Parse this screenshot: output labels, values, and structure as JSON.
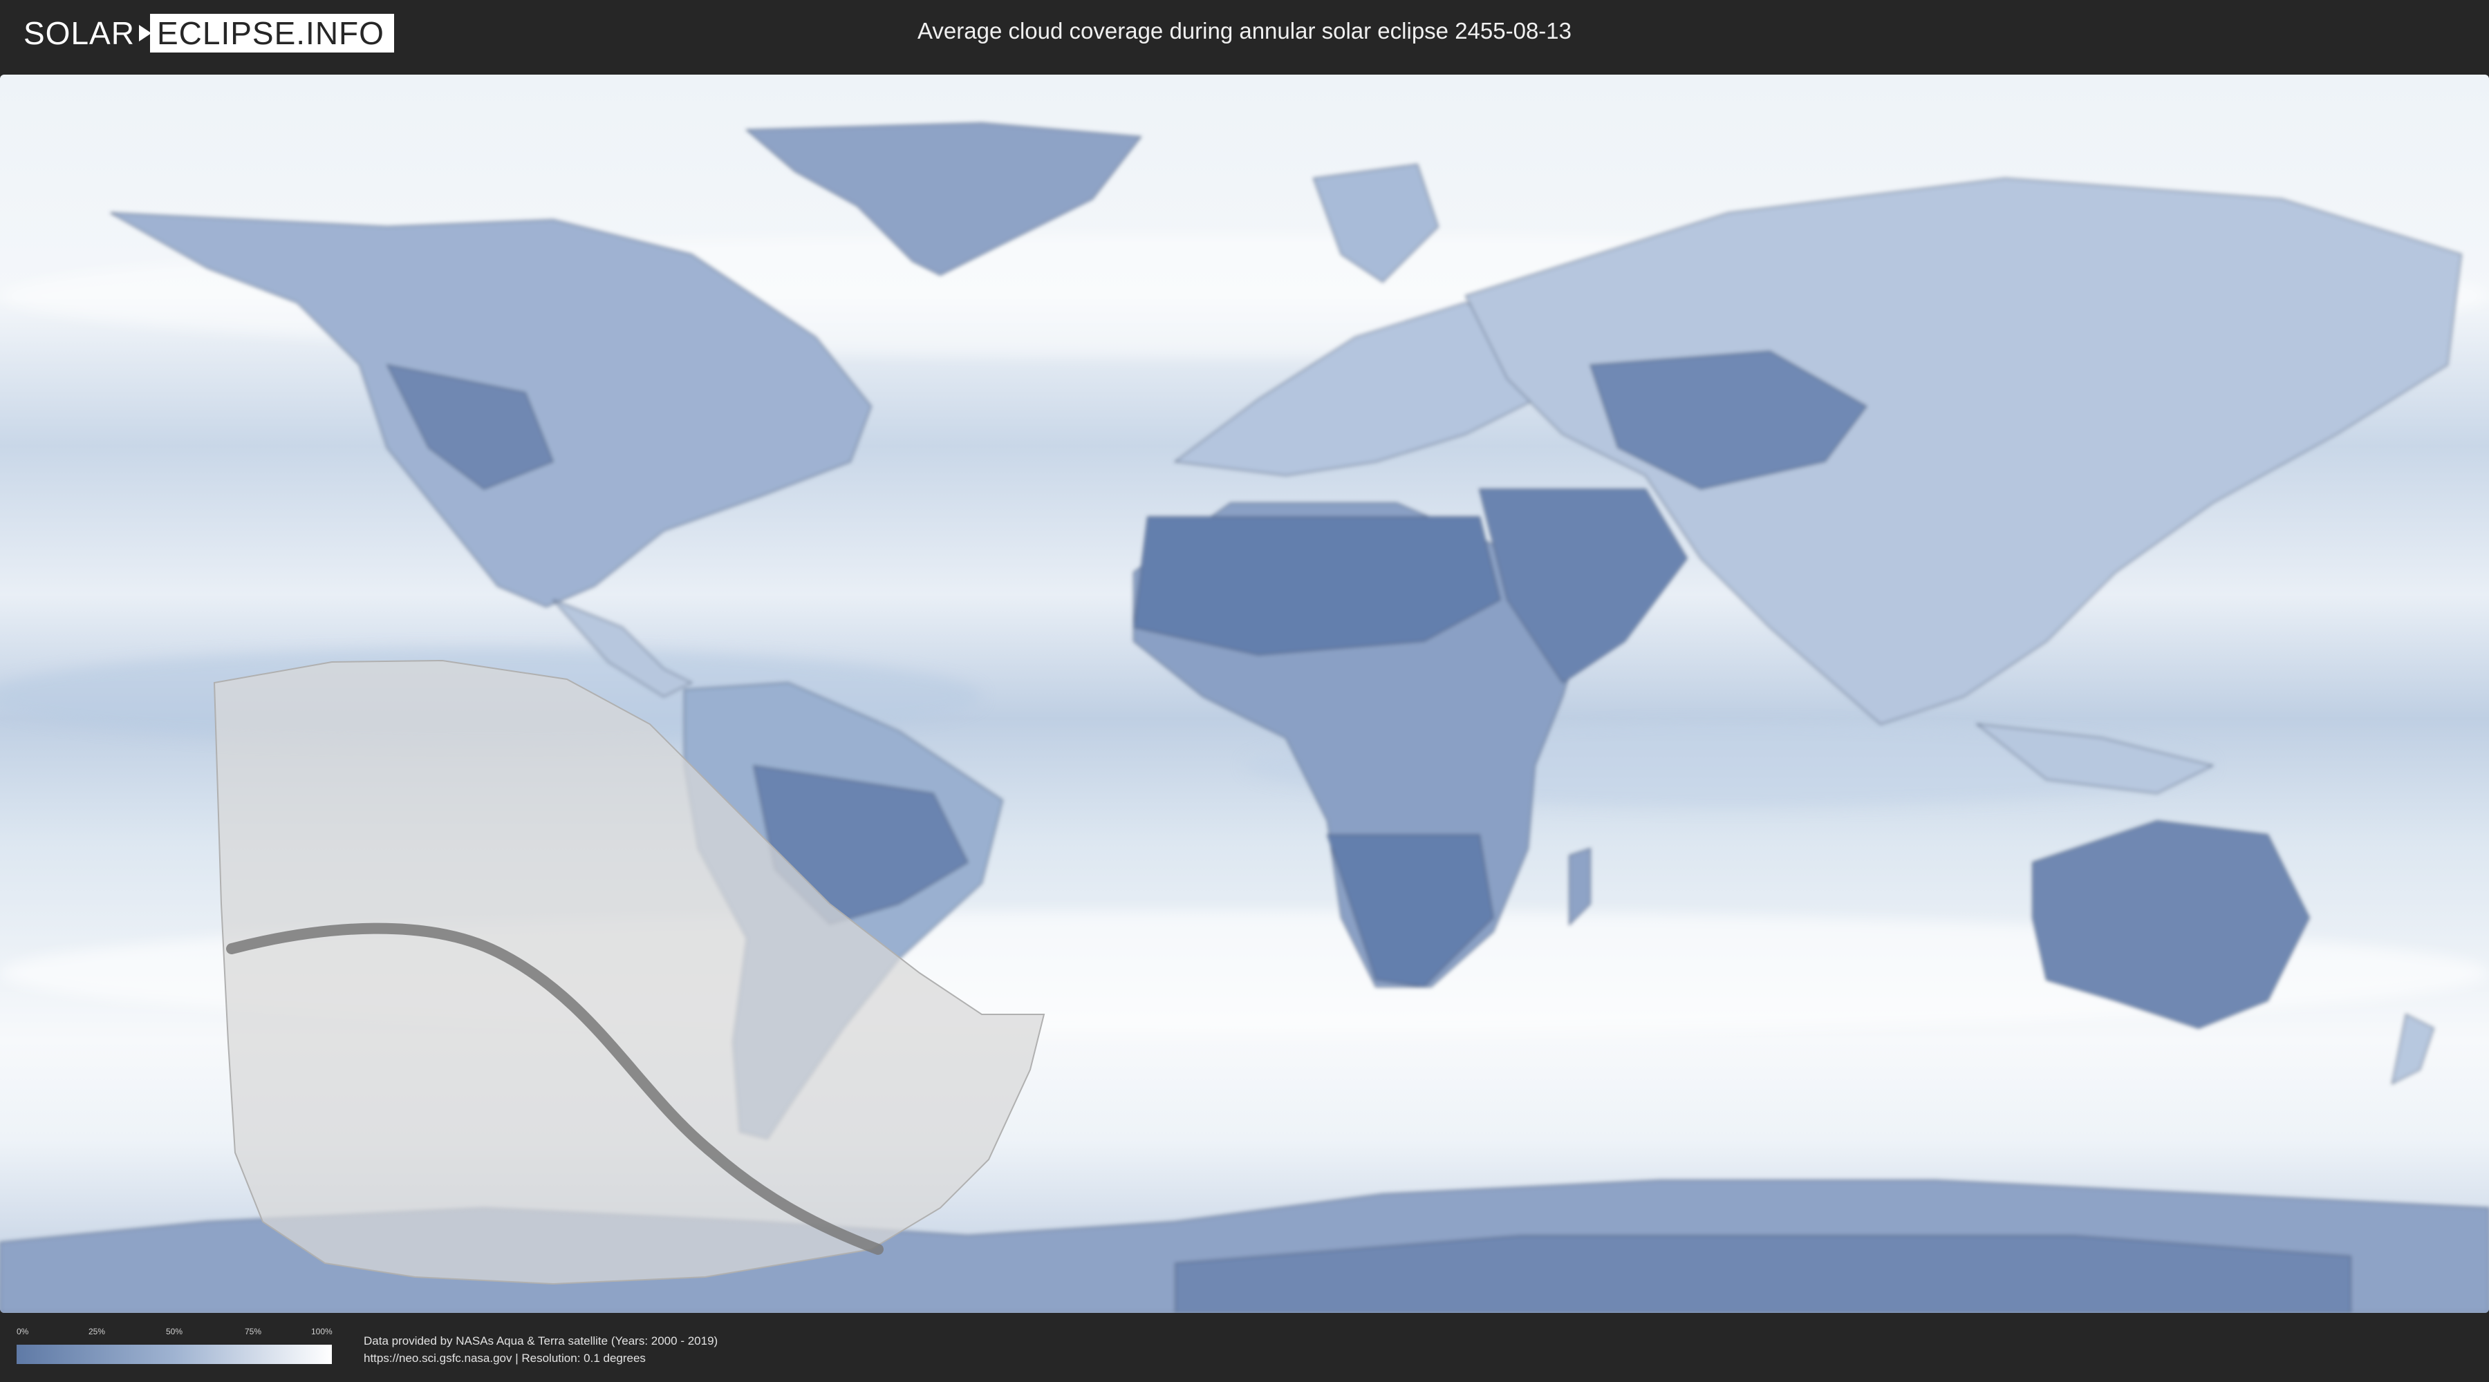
{
  "header": {
    "logo_left": "SOLAR",
    "logo_right": "ECLIPSE.INFO",
    "title": "Average cloud coverage during annular solar eclipse 2455-08-13"
  },
  "legend": {
    "ticks": [
      "0%",
      "25%",
      "50%",
      "75%",
      "100%"
    ],
    "colors": {
      "low": "#5f7aa6",
      "mid": "#9fb3d1",
      "high": "#ffffff"
    }
  },
  "credits": {
    "line1": "Data provided by NASAs Aqua & Terra satellite (Years: 2000 - 2019)",
    "line2": "https://neo.sci.gsfc.nasa.gov | Resolution: 0.1 degrees"
  },
  "map": {
    "projection": "equirectangular",
    "colors": {
      "ocean": "#dfe8f2",
      "clear_land": "#6f88b2",
      "cloudy": "#ffffff",
      "path_overlay": "#d8d8d8",
      "central_line": "#7a7a7a"
    }
  }
}
